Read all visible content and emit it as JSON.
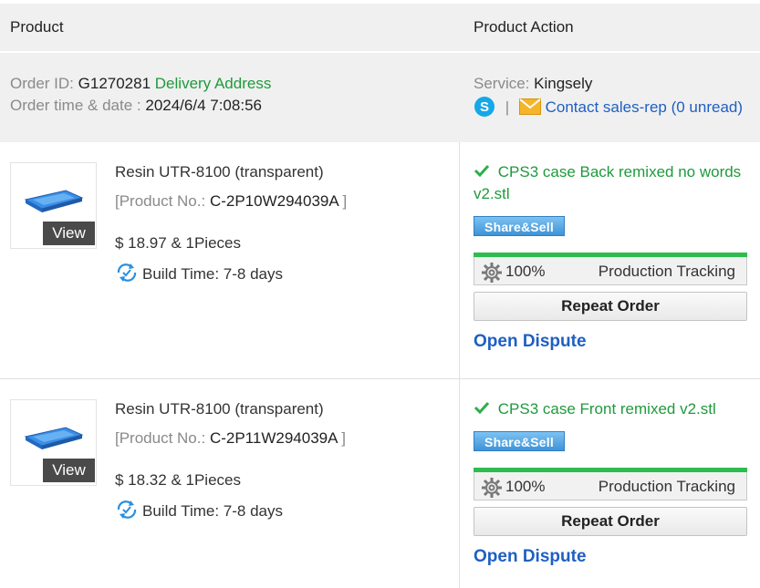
{
  "header": {
    "product_label": "Product",
    "action_label": "Product Action"
  },
  "order": {
    "id_label": "Order ID:",
    "id_value": "G1270281",
    "delivery_link": "Delivery Address",
    "time_label": "Order time & date :",
    "time_value": "2024/6/4 7:08:56",
    "service_label": "Service:",
    "service_value": "Kingsely",
    "separator": "|",
    "contact_link": "Contact sales-rep (0 unread)"
  },
  "items": [
    {
      "view_label": "View",
      "name": "Resin UTR-8100 (transparent)",
      "product_no_label": "[Product No.:",
      "product_no": "C-2P10W294039A",
      "product_no_close": "]",
      "price": "$ 18.97 & 1Pieces",
      "build_time": "Build Time: 7-8 days",
      "file_name": "CPS3 case Back remixed no words v2.stl",
      "share_label": "Share&Sell",
      "progress": 100,
      "progress_text": "100%",
      "tracking_label": "Production Tracking",
      "repeat_label": "Repeat Order",
      "dispute_label": "Open Dispute"
    },
    {
      "view_label": "View",
      "name": "Resin UTR-8100 (transparent)",
      "product_no_label": "[Product No.:",
      "product_no": "C-2P11W294039A",
      "product_no_close": "]",
      "price": "$ 18.32 & 1Pieces",
      "build_time": "Build Time: 7-8 days",
      "file_name": "CPS3 case Front remixed v2.stl",
      "share_label": "Share&Sell",
      "progress": 100,
      "progress_text": "100%",
      "tracking_label": "Production Tracking",
      "repeat_label": "Repeat Order",
      "dispute_label": "Open Dispute"
    }
  ],
  "icons": {
    "chat": "skype-icon",
    "mail": "mail-icon",
    "check": "check-icon",
    "gear": "gear-icon",
    "build": "clock-refresh-icon"
  },
  "colors": {
    "accent_green": "#1f9a3c",
    "link_blue": "#1f5fc2",
    "progress_green": "#2ebc4f"
  }
}
